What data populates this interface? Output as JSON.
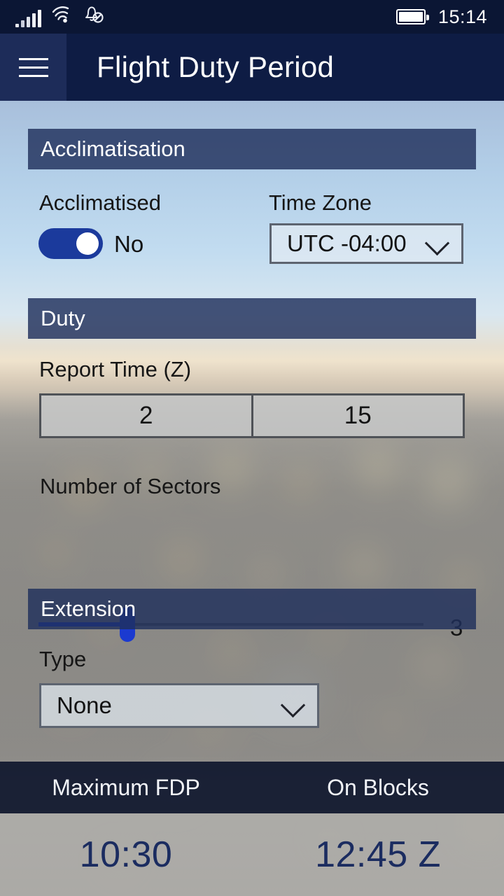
{
  "status_bar": {
    "signal_icon": "cellular-signal-icon",
    "wifi_icon": "wifi-icon",
    "notifications_icon": "notifications-off-icon",
    "battery_icon": "battery-full-icon",
    "time": "15:14"
  },
  "header": {
    "menu_icon": "hamburger-menu-icon",
    "title": "Flight Duty Period"
  },
  "sections": {
    "acclimatisation": {
      "title": "Acclimatisation",
      "acclimatised_label": "Acclimatised",
      "toggle_value": "No",
      "toggle_state": "off",
      "timezone_label": "Time Zone",
      "timezone_value": "UTC -04:00",
      "timezone_chevron": "chevron-down-icon"
    },
    "duty": {
      "title": "Duty",
      "report_time_label": "Report Time (Z)",
      "report_hours": "2",
      "report_minutes": "15",
      "sectors_label": "Number of Sectors",
      "sectors_value": "3",
      "sectors_percent": 23
    },
    "extension": {
      "title": "Extension",
      "type_label": "Type",
      "type_value": "None",
      "type_chevron": "chevron-down-icon"
    }
  },
  "summary": {
    "max_fdp_label": "Maximum FDP",
    "max_fdp_value": "10:30",
    "on_blocks_label": "On Blocks",
    "on_blocks_value": "12:45 Z"
  },
  "colors": {
    "status_bar": "#0b1634",
    "header": "#0e1c44",
    "section_header": "#202f5c",
    "accent_blue": "#1b3ad0",
    "toggle_on": "#1b3a9c",
    "summary_value": "#1b2c60"
  }
}
